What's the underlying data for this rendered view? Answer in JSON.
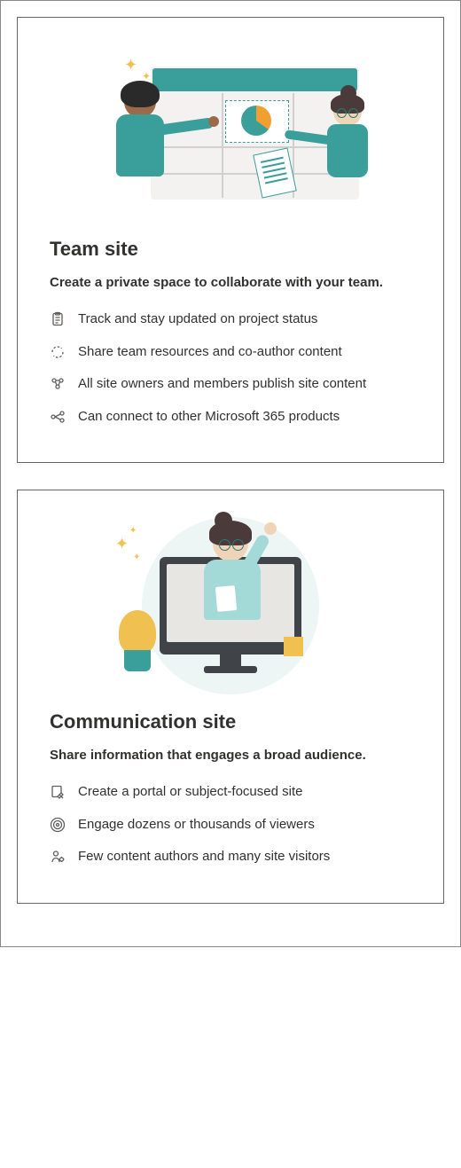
{
  "cards": [
    {
      "title": "Team site",
      "subtitle": "Create a private space to collaborate with your team.",
      "features": [
        {
          "icon": "clipboard-icon",
          "text": "Track and stay updated on project status"
        },
        {
          "icon": "cycle-icon",
          "text": "Share team resources and co-author content"
        },
        {
          "icon": "people-icon",
          "text": "All site owners and members publish site content"
        },
        {
          "icon": "connect-icon",
          "text": "Can connect to other Microsoft 365 products"
        }
      ]
    },
    {
      "title": "Communication site",
      "subtitle": "Share information that engages a broad audience.",
      "features": [
        {
          "icon": "page-icon",
          "text": "Create a portal or subject-focused site"
        },
        {
          "icon": "broadcast-icon",
          "text": "Engage dozens or thousands of viewers"
        },
        {
          "icon": "author-icon",
          "text": "Few content authors and many site visitors"
        }
      ]
    }
  ]
}
